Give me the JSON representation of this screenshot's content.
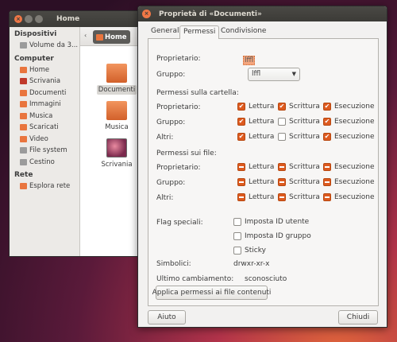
{
  "file_manager": {
    "title": "Home",
    "sidebar": [
      {
        "type": "head",
        "label": "Dispositivi"
      },
      {
        "type": "item",
        "label": "Volume da 3...",
        "icon": "drive-icon",
        "color": "#9b9b9b"
      },
      {
        "type": "head",
        "label": "Computer"
      },
      {
        "type": "item",
        "label": "Home",
        "icon": "home-folder-icon",
        "color": "#e9753e"
      },
      {
        "type": "item",
        "label": "Scrivania",
        "icon": "desktop-folder-icon",
        "color": "#c0392b"
      },
      {
        "type": "item",
        "label": "Documenti",
        "icon": "documents-folder-icon",
        "color": "#e9753e"
      },
      {
        "type": "item",
        "label": "Immagini",
        "icon": "pictures-folder-icon",
        "color": "#e9753e"
      },
      {
        "type": "item",
        "label": "Musica",
        "icon": "music-folder-icon",
        "color": "#e9753e"
      },
      {
        "type": "item",
        "label": "Scaricati",
        "icon": "downloads-folder-icon",
        "color": "#e9753e"
      },
      {
        "type": "item",
        "label": "Video",
        "icon": "videos-folder-icon",
        "color": "#e9753e"
      },
      {
        "type": "item",
        "label": "File system",
        "icon": "filesystem-icon",
        "color": "#9b9b9b"
      },
      {
        "type": "item",
        "label": "Cestino",
        "icon": "trash-icon",
        "color": "#9b9b9b"
      },
      {
        "type": "head",
        "label": "Rete"
      },
      {
        "type": "item",
        "label": "Esplora rete",
        "icon": "network-icon",
        "color": "#e9753e"
      }
    ],
    "breadcrumb": "Home",
    "files": [
      {
        "label": "Documenti",
        "icon": "documents-folder-icon",
        "selected": true
      },
      {
        "label": "Musica",
        "icon": "music-folder-icon",
        "selected": false
      },
      {
        "label": "Scrivania",
        "icon": "desktop-folder-icon",
        "selected": false
      }
    ]
  },
  "dialog": {
    "title": "Proprietà di «Documenti»",
    "tabs": [
      "Generali",
      "Permessi",
      "Condivisione"
    ],
    "active_tab": "Permessi",
    "owner_label": "Proprietario:",
    "owner_value": "lffl",
    "group_label": "Gruppo:",
    "group_value": "lffl",
    "folder_section": "Permessi sulla cartella:",
    "file_section": "Permessi sui file:",
    "row_labels": [
      "Proprietario:",
      "Gruppo:",
      "Altri:"
    ],
    "perm_labels": [
      "Lettura",
      "Scrittura",
      "Esecuzione"
    ],
    "folder_perms": [
      [
        "checked",
        "checked",
        "checked"
      ],
      [
        "checked",
        "empty",
        "checked"
      ],
      [
        "checked",
        "empty",
        "checked"
      ]
    ],
    "file_perms": [
      [
        "mixed",
        "mixed",
        "mixed"
      ],
      [
        "mixed",
        "mixed",
        "mixed"
      ],
      [
        "mixed",
        "mixed",
        "mixed"
      ]
    ],
    "special_label": "Flag speciali:",
    "special_flags": [
      "Imposta ID utente",
      "Imposta ID gruppo",
      "Sticky"
    ],
    "symbolic_label": "Simbolici:",
    "symbolic_value": "drwxr-xr-x",
    "last_change_label": "Ultimo cambiamento:",
    "last_change_value": "sconosciuto",
    "apply_button": "Applica permessi ai file contenuti",
    "help_button": "Aiuto",
    "close_button": "Chiudi"
  },
  "colors": {
    "accent": "#dd5a1f",
    "titlebar": "#3c3b37",
    "folder": "#e9753e"
  }
}
